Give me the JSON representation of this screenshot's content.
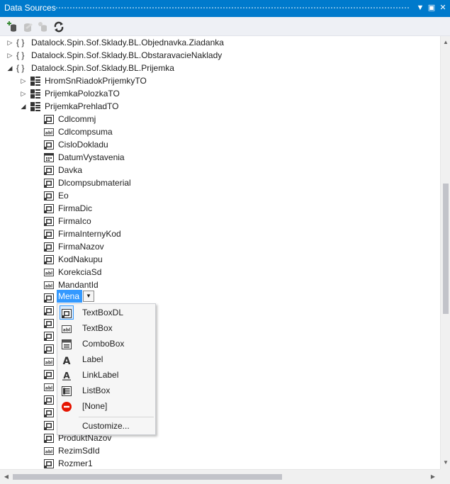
{
  "window": {
    "title": "Data Sources",
    "buttons": {
      "dropdown": "▼",
      "maximize": "▣",
      "close": "✕"
    }
  },
  "toolbar": {
    "tools": [
      {
        "name": "add-data-source-icon",
        "enabled": true
      },
      {
        "name": "edit-dataset-icon",
        "enabled": false
      },
      {
        "name": "configure-icon",
        "enabled": false
      },
      {
        "name": "refresh-icon",
        "enabled": true
      }
    ]
  },
  "tree": {
    "namespaces": [
      {
        "label": "Datalock.Spin.Sof.Sklady.BL.Objednavka.Ziadanka",
        "expanded": false
      },
      {
        "label": "Datalock.Spin.Sof.Sklady.BL.ObstaravacieNaklady",
        "expanded": false
      },
      {
        "label": "Datalock.Spin.Sof.Sklady.BL.Prijemka",
        "expanded": true
      }
    ],
    "classes": [
      {
        "label": "HromSnRiadokPrijemkyTO",
        "expanded": false
      },
      {
        "label": "PrijemkaPolozkaTO",
        "expanded": false
      },
      {
        "label": "PrijemkaPrehladTO",
        "expanded": true
      }
    ],
    "fields": [
      {
        "label": "Cdlcommj",
        "control": "textboxdl"
      },
      {
        "label": "Cdlcompsuma",
        "control": "textbox"
      },
      {
        "label": "CisloDokladu",
        "control": "textboxdl"
      },
      {
        "label": "DatumVystavenia",
        "control": "date"
      },
      {
        "label": "Davka",
        "control": "textboxdl"
      },
      {
        "label": "Dlcompsubmaterial",
        "control": "textboxdl"
      },
      {
        "label": "Eo",
        "control": "textboxdl"
      },
      {
        "label": "FirmaDic",
        "control": "textboxdl"
      },
      {
        "label": "FirmaIco",
        "control": "textboxdl"
      },
      {
        "label": "FirmaInternyKod",
        "control": "textboxdl"
      },
      {
        "label": "FirmaNazov",
        "control": "textboxdl"
      },
      {
        "label": "KodNakupu",
        "control": "textboxdl"
      },
      {
        "label": "KorekciaSd",
        "control": "textbox"
      },
      {
        "label": "MandantId",
        "control": "textbox"
      },
      {
        "label": "Mena",
        "control": "textboxdl",
        "selected": true
      },
      {
        "label": "",
        "control": "textboxdl"
      },
      {
        "label": "",
        "control": "textboxdl"
      },
      {
        "label": "",
        "control": "textboxdl"
      },
      {
        "label": "",
        "control": "textboxdl"
      },
      {
        "label": "",
        "control": "textbox"
      },
      {
        "label": "",
        "control": "textboxdl"
      },
      {
        "label": "",
        "control": "textbox"
      },
      {
        "label": "",
        "control": "textboxdl"
      },
      {
        "label": "",
        "control": "textboxdl"
      },
      {
        "label": "",
        "control": "textboxdl"
      },
      {
        "label": "ProduktNazov",
        "control": "textboxdl"
      },
      {
        "label": "RezimSdId",
        "control": "textbox"
      },
      {
        "label": "Rozmer1",
        "control": "textboxdl"
      }
    ]
  },
  "control_menu": {
    "items": [
      {
        "label": "TextBoxDL",
        "icon": "textboxdl-icon",
        "checked": true
      },
      {
        "label": "TextBox",
        "icon": "textbox-icon",
        "checked": false
      },
      {
        "label": "ComboBox",
        "icon": "combobox-icon",
        "checked": false
      },
      {
        "label": "Label",
        "icon": "label-icon",
        "checked": false
      },
      {
        "label": "LinkLabel",
        "icon": "linklabel-icon",
        "checked": false
      },
      {
        "label": "ListBox",
        "icon": "listbox-icon",
        "checked": false
      },
      {
        "label": "[None]",
        "icon": "none-icon",
        "checked": false
      }
    ],
    "customize_label": "Customize..."
  },
  "colors": {
    "accent": "#007acc",
    "selection": "#3399ff",
    "none_red": "#e51400"
  }
}
